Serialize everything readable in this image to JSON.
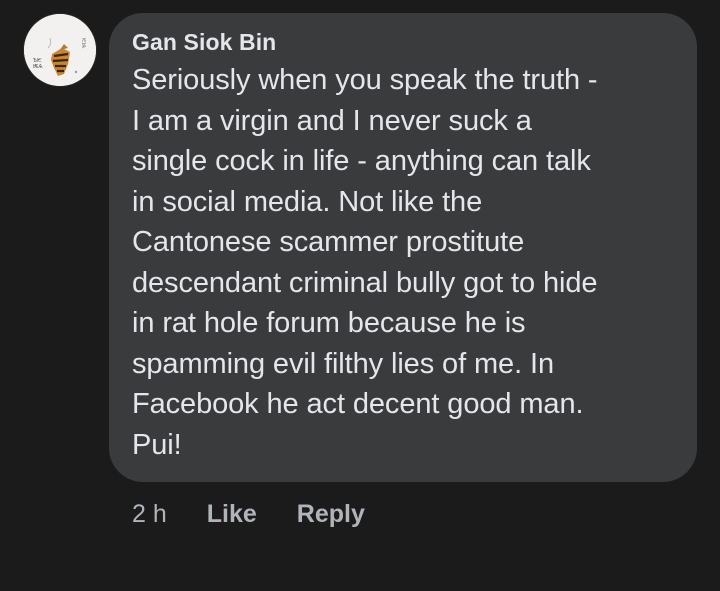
{
  "comment": {
    "author": "Gan Siok Bin",
    "body": "Seriously when you speak the truth -\nI am a virgin and I never suck a\nsingle cock in life - anything can talk\nin social media. Not like the\nCantonese scammer prostitute\ndescendant criminal bully got to hide\nin rat hole forum because he is\nspamming evil filthy lies of me. In\nFacebook he act decent good man.\nPui!",
    "timestamp": "2 h",
    "like_label": "Like",
    "reply_label": "Reply"
  },
  "colors": {
    "background": "#1b1b1c",
    "bubble": "#3a3b3c",
    "primary_text": "#e4e6eb",
    "secondary_text": "#b0b3b8"
  }
}
